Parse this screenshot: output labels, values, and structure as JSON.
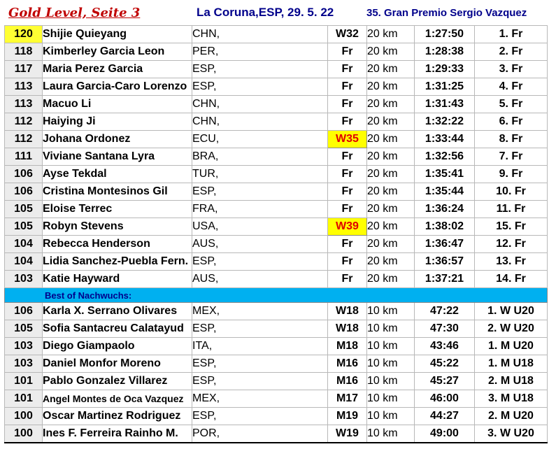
{
  "header": {
    "title": "Gold Level, Seite 3",
    "event": "La Coruna,ESP, 29. 5. 22",
    "race": "35. Gran Premio Sergio Vazquez"
  },
  "highlight_color": "#ffff00",
  "section_color": "#00b0f0",
  "results": [
    {
      "points": "120",
      "name": "Shijie Quieyang",
      "country": "CHN,",
      "category": "W32",
      "distance": "20 km",
      "time": "1:27:50",
      "place": "1. Fr",
      "points_highlight": true,
      "category_highlight": false
    },
    {
      "points": "118",
      "name": "Kimberley Garcia Leon",
      "country": "PER,",
      "category": "Fr",
      "distance": "20 km",
      "time": "1:28:38",
      "place": "2. Fr",
      "points_highlight": false,
      "category_highlight": false
    },
    {
      "points": "117",
      "name": "Maria Perez Garcia",
      "country": "ESP,",
      "category": "Fr",
      "distance": "20 km",
      "time": "1:29:33",
      "place": "3. Fr",
      "points_highlight": false,
      "category_highlight": false
    },
    {
      "points": "113",
      "name": "Laura Garcia-Caro Lorenzo",
      "country": "ESP,",
      "category": "Fr",
      "distance": "20 km",
      "time": "1:31:25",
      "place": "4. Fr",
      "points_highlight": false,
      "category_highlight": false
    },
    {
      "points": "113",
      "name": "Macuo Li",
      "country": "CHN,",
      "category": "Fr",
      "distance": "20 km",
      "time": "1:31:43",
      "place": "5. Fr",
      "points_highlight": false,
      "category_highlight": false
    },
    {
      "points": "112",
      "name": "Haiying Ji",
      "country": "CHN,",
      "category": "Fr",
      "distance": "20 km",
      "time": "1:32:22",
      "place": "6. Fr",
      "points_highlight": false,
      "category_highlight": false
    },
    {
      "points": "112",
      "name": "Johana Ordonez",
      "country": "ECU,",
      "category": "W35",
      "distance": "20 km",
      "time": "1:33:44",
      "place": "8. Fr",
      "points_highlight": false,
      "category_highlight": true
    },
    {
      "points": "111",
      "name": "Viviane Santana Lyra",
      "country": "BRA,",
      "category": "Fr",
      "distance": "20 km",
      "time": "1:32:56",
      "place": "7. Fr",
      "points_highlight": false,
      "category_highlight": false
    },
    {
      "points": "106",
      "name": "Ayse Tekdal",
      "country": "TUR,",
      "category": "Fr",
      "distance": "20 km",
      "time": "1:35:41",
      "place": "9. Fr",
      "points_highlight": false,
      "category_highlight": false
    },
    {
      "points": "106",
      "name": "Cristina Montesinos Gil",
      "country": "ESP,",
      "category": "Fr",
      "distance": "20 km",
      "time": "1:35:44",
      "place": "10. Fr",
      "points_highlight": false,
      "category_highlight": false
    },
    {
      "points": "105",
      "name": "Eloise Terrec",
      "country": "FRA,",
      "category": "Fr",
      "distance": "20 km",
      "time": "1:36:24",
      "place": "11. Fr",
      "points_highlight": false,
      "category_highlight": false
    },
    {
      "points": "105",
      "name": "Robyn Stevens",
      "country": "USA,",
      "category": "W39",
      "distance": "20 km",
      "time": "1:38:02",
      "place": "15. Fr",
      "points_highlight": false,
      "category_highlight": true
    },
    {
      "points": "104",
      "name": "Rebecca Henderson",
      "country": "AUS,",
      "category": "Fr",
      "distance": "20 km",
      "time": "1:36:47",
      "place": "12. Fr",
      "points_highlight": false,
      "category_highlight": false
    },
    {
      "points": "104",
      "name": "Lidia Sanchez-Puebla Fern.",
      "country": "ESP,",
      "category": "Fr",
      "distance": "20 km",
      "time": "1:36:57",
      "place": "13. Fr",
      "points_highlight": false,
      "category_highlight": false
    },
    {
      "points": "103",
      "name": "Katie Hayward",
      "country": "AUS,",
      "category": "Fr",
      "distance": "20 km",
      "time": "1:37:21",
      "place": "14. Fr",
      "points_highlight": false,
      "category_highlight": false
    }
  ],
  "section_label": "Best of Nachwuchs:",
  "youth": [
    {
      "points": "106",
      "name": "Karla X. Serrano Olivares",
      "country": "MEX,",
      "category": "W18",
      "distance": "10 km",
      "time": "47:22",
      "place": "1. W U20",
      "small": false
    },
    {
      "points": "105",
      "name": "Sofia Santacreu Calatayud",
      "country": "ESP,",
      "category": "W18",
      "distance": "10 km",
      "time": "47:30",
      "place": "2. W U20",
      "small": false
    },
    {
      "points": "103",
      "name": "Diego Giampaolo",
      "country": "ITA,",
      "category": "M18",
      "distance": "10 km",
      "time": "43:46",
      "place": "1. M U20",
      "small": false
    },
    {
      "points": "103",
      "name": "Daniel Monfor Moreno",
      "country": "ESP,",
      "category": "M16",
      "distance": "10 km",
      "time": "45:22",
      "place": "1. M U18",
      "small": false
    },
    {
      "points": "101",
      "name": "Pablo Gonzalez Villarez",
      "country": "ESP,",
      "category": "M16",
      "distance": "10 km",
      "time": "45:27",
      "place": "2. M U18",
      "small": false
    },
    {
      "points": "101",
      "name": "Angel Montes de Oca Vazquez",
      "country": "MEX,",
      "category": "M17",
      "distance": "10 km",
      "time": "46:00",
      "place": "3. M U18",
      "small": true
    },
    {
      "points": "100",
      "name": "Oscar Martinez Rodriguez",
      "country": "ESP,",
      "category": "M19",
      "distance": "10 km",
      "time": "44:27",
      "place": "2. M U20",
      "small": false
    },
    {
      "points": "100",
      "name": "Ines F. Ferreira Rainho M.",
      "country": "POR,",
      "category": "W19",
      "distance": "10 km",
      "time": "49:00",
      "place": "3. W U20",
      "small": false
    }
  ]
}
